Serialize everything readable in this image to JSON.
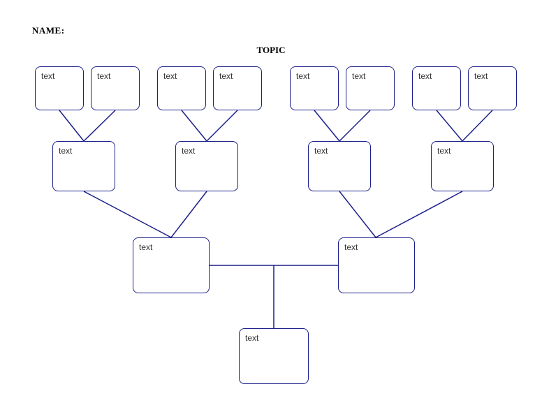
{
  "header": {
    "name_label": "NAME:",
    "topic_label": "TOPIC"
  },
  "row1": [
    {
      "label": "text"
    },
    {
      "label": "text"
    },
    {
      "label": "text"
    },
    {
      "label": "text"
    },
    {
      "label": "text"
    },
    {
      "label": "text"
    },
    {
      "label": "text"
    },
    {
      "label": "text"
    }
  ],
  "row2": [
    {
      "label": "text"
    },
    {
      "label": "text"
    },
    {
      "label": "text"
    },
    {
      "label": "text"
    }
  ],
  "row3": [
    {
      "label": "text"
    },
    {
      "label": "text"
    }
  ],
  "row4": [
    {
      "label": "text"
    }
  ],
  "colors": {
    "border": "#1b1f8a"
  }
}
